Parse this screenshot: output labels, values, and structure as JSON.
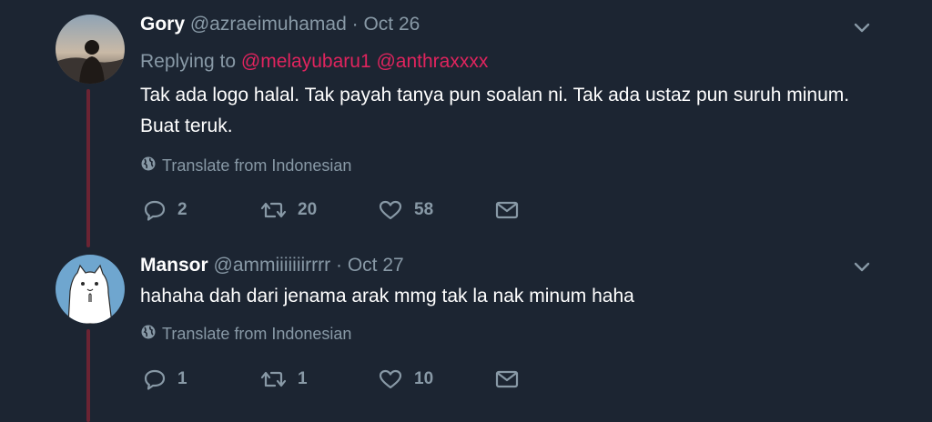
{
  "tweets": [
    {
      "name": "Gory",
      "handle": "@azraeimuhamad",
      "separator": "·",
      "date": "Oct 26",
      "replying_prefix": "Replying to",
      "mentions": [
        "@melayubaru1",
        "@anthraxxxx"
      ],
      "text": "Tak ada logo halal. Tak payah tanya pun soalan ni. Tak ada ustaz pun suruh minum. Buat teruk.",
      "translate": "Translate from Indonesian",
      "replies": "2",
      "retweets": "20",
      "likes": "58"
    },
    {
      "name": "Mansor",
      "handle": "@ammiiiiiiirrrr",
      "separator": "·",
      "date": "Oct 27",
      "text": "hahaha dah dari jenama arak mmg tak la nak minum haha",
      "translate": "Translate from Indonesian",
      "replies": "1",
      "retweets": "1",
      "likes": "10"
    }
  ],
  "colors": {
    "background": "#1c2532",
    "muted": "#8899a6",
    "mention": "#e0245e",
    "thread_line": "#6b2433"
  },
  "icons": [
    "chevron-down-icon",
    "globe-icon",
    "reply-icon",
    "retweet-icon",
    "heart-icon",
    "envelope-icon"
  ]
}
